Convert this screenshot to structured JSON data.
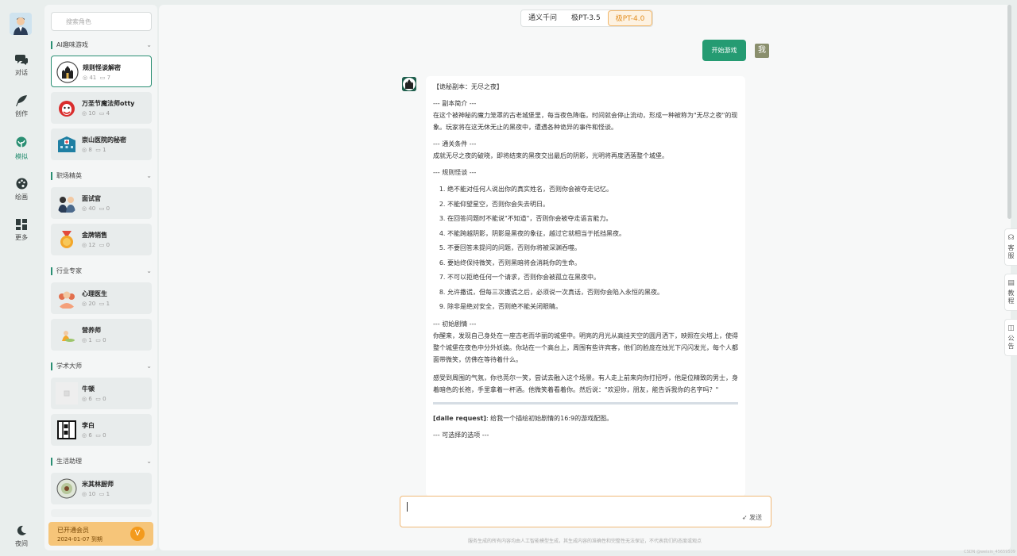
{
  "rail": {
    "items": [
      {
        "label": "对话",
        "icon": "chat-icon"
      },
      {
        "label": "创作",
        "icon": "feather-icon"
      },
      {
        "label": "模拟",
        "icon": "sprout-icon"
      },
      {
        "label": "绘画",
        "icon": "palette-icon"
      },
      {
        "label": "更多",
        "icon": "grid-icon"
      }
    ],
    "night_label": "夜间",
    "accent": "#2a8f73"
  },
  "search": {
    "placeholder": "搜索角色"
  },
  "sections": [
    {
      "title": "AI趣味游戏",
      "cards": [
        {
          "name": "规则怪谈解密",
          "views": "41",
          "chats": "7"
        },
        {
          "name": "万圣节魔法师otty",
          "views": "10",
          "chats": "4"
        },
        {
          "name": "崇山医院的秘密",
          "views": "8",
          "chats": "1"
        }
      ]
    },
    {
      "title": "职场精英",
      "cards": [
        {
          "name": "面试官",
          "views": "40",
          "chats": "0"
        },
        {
          "name": "金牌销售",
          "views": "12",
          "chats": "0"
        }
      ]
    },
    {
      "title": "行业专家",
      "cards": [
        {
          "name": "心理医生",
          "views": "20",
          "chats": "1"
        },
        {
          "name": "营养师",
          "views": "1",
          "chats": "0"
        }
      ]
    },
    {
      "title": "学术大师",
      "cards": [
        {
          "name": "牛顿",
          "views": "6",
          "chats": "0"
        },
        {
          "name": "李白",
          "views": "6",
          "chats": "0"
        }
      ]
    },
    {
      "title": "生活助理",
      "cards": [
        {
          "name": "米其林厨师",
          "views": "10",
          "chats": "1"
        }
      ]
    }
  ],
  "vip": {
    "title": "已开通会员",
    "expire": "2024-01-07 到期",
    "badge": "V"
  },
  "models": [
    "通义千问",
    "极PT-3.5",
    "极PT-4.0"
  ],
  "chat": {
    "start_button": "开始游戏",
    "user_badge": "我",
    "message": {
      "title": "【诡秘副本：无尽之夜】",
      "intro_head": "--- 副本简介 ---",
      "intro_text": "在这个被神秘的魔力笼罩的古老城堡里，每当夜色降临，时间就会停止流动，形成一种被称为\"无尽之夜\"的现象。玩家将在这无休无止的黑夜中，遭遇各种诡异的事件和怪谈。",
      "cond_head": "--- 通关条件 ---",
      "cond_text": "成就无尽之夜的破晓，即将结束的黑夜交出最后的阴影，光明将再度洒落整个城堡。",
      "rules_head": "--- 规则怪谈 ---",
      "rules": [
        "绝不能对任何人说出你的真实姓名，否则你会被夺走记忆。",
        "不能仰望星空，否则你会失去明日。",
        "在回答问题时不能说\"不知道\"，否则你会被夺走语言能力。",
        "不能跨越阴影，阴影是黑夜的象征，越过它就相当于抵挡黑夜。",
        "不要回答未提问的问题，否则你将被深渊吞噬。",
        "要始终保持微笑，否则黑暗将会消耗你的生命。",
        "不可以拒绝任何一个请求，否则你会被孤立在黑夜中。",
        "允许撒谎，但每三次撒谎之后，必须说一次真话，否则你会陷入永恒的黑夜。",
        "除非是绝对安全，否则绝不能关闭眼睛。"
      ],
      "plot_head": "--- 初始剧情 ---",
      "plot_text1": "你醒来，发现自己身处在一座古老而华丽的城堡中。明亮的月光从高挂天空的圆月洒下，映照在尖塔上，使得整个城堡在夜色中分外妖娆。你站在一个高台上，周围有些许宾客，他们的脸庞在烛光下闪闪发光，每个人都面带微笑，仿佛在等待着什么。",
      "plot_text2": "感受到周围的气氛，你也莞尔一笑，尝试去融入这个场景。有人走上前来向你打招呼，他是位精致的男士，身着暗色的长袍，手里拿着一杯酒。他微笑着看着你。然后说：\"欢迎你，朋友，能告诉我你的名字吗？\"",
      "dalle_label": "[dalle request]",
      "dalle_text": ": 给我一个描绘初始剧情的16:9的游戏配图。",
      "options_head": "--- 可选择的选项 ---"
    }
  },
  "input": {
    "send_label": "发送"
  },
  "footer_note": "服务生成的所有内容均由人工智能模型生成，其生成内容的准确性和完整性无法保证，不代表我们的态度或观点",
  "side_tabs": [
    {
      "label": "客服",
      "icon": "headset-icon"
    },
    {
      "label": "教程",
      "icon": "book-icon"
    },
    {
      "label": "公告",
      "icon": "notice-icon"
    }
  ],
  "watermark": "CSDN @weixin_45659509",
  "colors": {
    "primary": "#259b72",
    "model_active": "#e38f22",
    "vip": "#f6c579"
  }
}
